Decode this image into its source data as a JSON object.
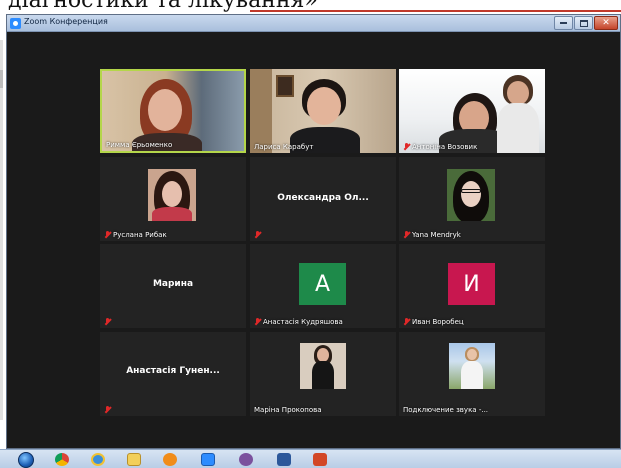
{
  "document": {
    "heading_fragment": "діагностики та лікування»"
  },
  "window": {
    "title": "Zoom Конференция",
    "buttons": [
      "minimize",
      "maximize",
      "close"
    ]
  },
  "participants": [
    {
      "name": "Римма Єрьоменко",
      "display": "video",
      "active_speaker": true,
      "muted": false
    },
    {
      "name": "Лариса Карабут",
      "display": "video",
      "active_speaker": false,
      "muted": false
    },
    {
      "name": "Антоніна Возовик",
      "display": "video",
      "active_speaker": false,
      "muted": true
    },
    {
      "name": "Руслана Рибак",
      "display": "photo",
      "active_speaker": false,
      "muted": true
    },
    {
      "name": "Олександра Ол...",
      "display": "name",
      "active_speaker": false,
      "muted": true
    },
    {
      "name": "Yana Mendryk",
      "display": "photo",
      "active_speaker": false,
      "muted": true
    },
    {
      "name": "Марина",
      "display": "name",
      "active_speaker": false,
      "muted": true
    },
    {
      "name": "Анастасія Кудряшова",
      "display": "initial",
      "initial": "А",
      "initial_color": "#1e8a4a",
      "active_speaker": false,
      "muted": true
    },
    {
      "name": "Иван Воробец",
      "display": "initial",
      "initial": "И",
      "initial_color": "#c8174f",
      "active_speaker": false,
      "muted": true
    },
    {
      "name": "Анастасія Гунен...",
      "display": "name",
      "active_speaker": false,
      "muted": true
    },
    {
      "name": "Маріна Прокопова",
      "display": "photo",
      "active_speaker": false,
      "muted": false
    },
    {
      "name": "Подключение звука -...",
      "display": "photo",
      "active_speaker": false,
      "muted": false
    }
  ],
  "taskbar": {
    "items": [
      "start-orb",
      "chrome",
      "internet-explorer",
      "file-explorer",
      "media-player",
      "zoom",
      "viber",
      "word",
      "powerpoint"
    ]
  },
  "colors": {
    "window_bg": "#1a1a1a",
    "tile_bg": "#232323",
    "active_border": "#b4d64a",
    "muted_red": "#e02828"
  }
}
